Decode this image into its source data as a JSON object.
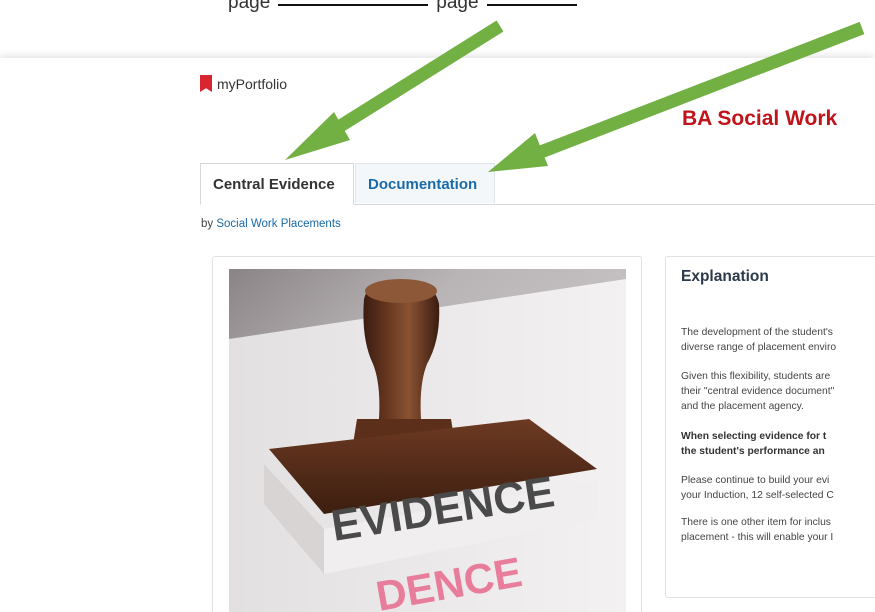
{
  "annotation": {
    "top_text_left": "page",
    "top_text_right": "page"
  },
  "app": {
    "name": "myPortfolio"
  },
  "page": {
    "title": "BA Social Work"
  },
  "tabs": [
    {
      "label": "Central Evidence",
      "active": true
    },
    {
      "label": "Documentation",
      "active": false
    }
  ],
  "byline": {
    "prefix": "by",
    "author": "Social Work Placements"
  },
  "image_card": {
    "stamp_text": "EVIDENCE",
    "imprint_text": "DENCE"
  },
  "explanation": {
    "title": "Explanation",
    "paragraphs": [
      {
        "lines": [
          "The development of the student's",
          "diverse range of placement enviro"
        ],
        "bold": false
      },
      {
        "lines": [
          " Given this flexibility, students are",
          "their \"central evidence document\"",
          "and the placement agency."
        ],
        "bold": false
      },
      {
        "lines": [
          "When selecting evidence for t",
          "the student's performance an"
        ],
        "bold": true
      },
      {
        "lines": [
          " Please continue to build your evi",
          "your Induction, 12 self-selected C"
        ],
        "bold": false
      },
      {
        "lines": [
          "There is one other item for inclus",
          "placement - this will enable your I"
        ],
        "bold": false
      }
    ]
  },
  "colors": {
    "brand_red": "#d7262f",
    "title_red": "#c0141b",
    "link_blue": "#1a6aa8",
    "arrow_green": "#72b043"
  }
}
